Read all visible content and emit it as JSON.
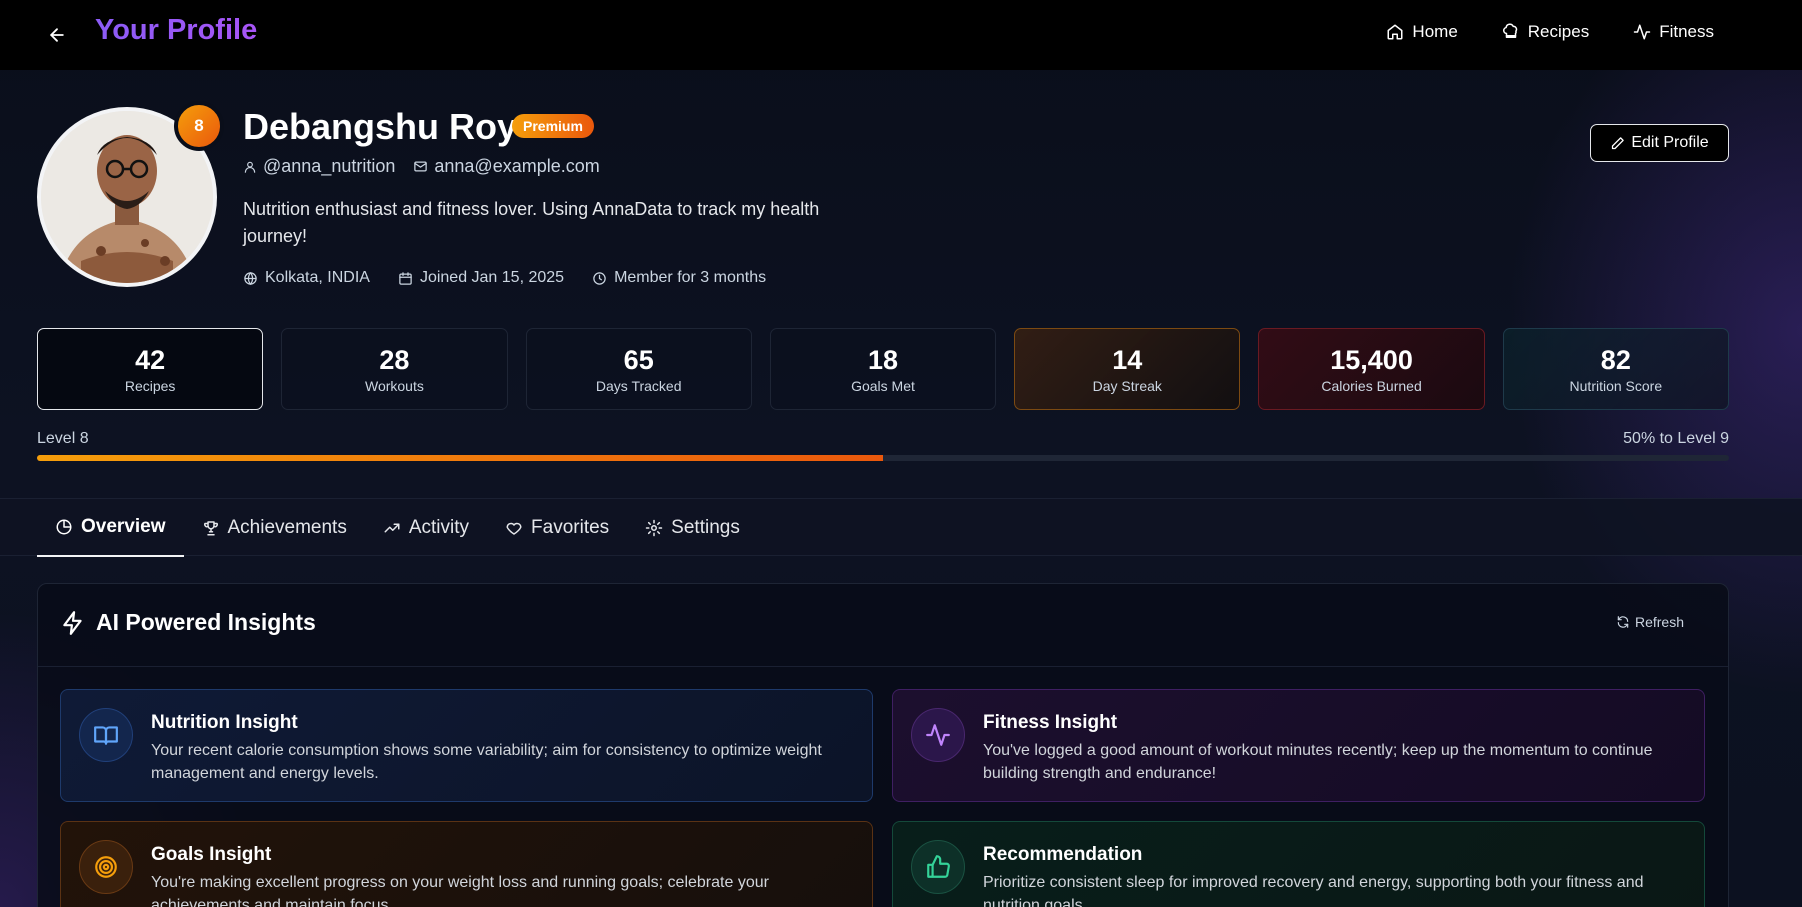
{
  "header": {
    "title": "Your Profile",
    "nav": [
      {
        "label": "Home",
        "icon": "home-icon"
      },
      {
        "label": "Recipes",
        "icon": "chef-hat-icon"
      },
      {
        "label": "Fitness",
        "icon": "activity-icon"
      }
    ]
  },
  "profile": {
    "name": "Debangshu Roy",
    "badge": "Premium",
    "level_badge": "8",
    "username": "@anna_nutrition",
    "email": "anna@example.com",
    "bio": "Nutrition enthusiast and fitness lover. Using AnnaData to track my health journey!",
    "location": "Kolkata, INDIA",
    "joined": "Joined Jan 15, 2025",
    "member_for": "Member for 3 months",
    "edit_label": "Edit Profile"
  },
  "stats": [
    {
      "value": "42",
      "label": "Recipes"
    },
    {
      "value": "28",
      "label": "Workouts"
    },
    {
      "value": "65",
      "label": "Days Tracked"
    },
    {
      "value": "18",
      "label": "Goals Met"
    },
    {
      "value": "14",
      "label": "Day Streak"
    },
    {
      "value": "15,400",
      "label": "Calories Burned"
    },
    {
      "value": "82",
      "label": "Nutrition Score"
    }
  ],
  "level": {
    "current": "Level 8",
    "next": "50% to Level 9",
    "progress_fraction": 0.5
  },
  "tabs": [
    {
      "label": "Overview"
    },
    {
      "label": "Achievements"
    },
    {
      "label": "Activity"
    },
    {
      "label": "Favorites"
    },
    {
      "label": "Settings"
    }
  ],
  "insights": {
    "title": "AI Powered Insights",
    "refresh_label": "Refresh",
    "cards": [
      {
        "title": "Nutrition Insight",
        "text": "Your recent calorie consumption shows some variability; aim for consistency to optimize weight management and energy levels.",
        "icon": "book-open-icon",
        "accent": "#60a5fa"
      },
      {
        "title": "Fitness Insight",
        "text": "You've logged a good amount of workout minutes recently; keep up the momentum to continue building strength and endurance!",
        "icon": "activity-icon",
        "accent": "#c084fc"
      },
      {
        "title": "Goals Insight",
        "text": "You're making excellent progress on your weight loss and running goals; celebrate your achievements and maintain focus.",
        "icon": "target-icon",
        "accent": "#f59e0b"
      },
      {
        "title": "Recommendation",
        "text": "Prioritize consistent sleep for improved recovery and energy, supporting both your fitness and nutrition goals.",
        "icon": "thumbs-up-icon",
        "accent": "#34d399"
      }
    ]
  },
  "colors": {
    "brand": "#8b5cf6",
    "accent_orange": "#f59e0b",
    "background": "#0b0f1c"
  }
}
